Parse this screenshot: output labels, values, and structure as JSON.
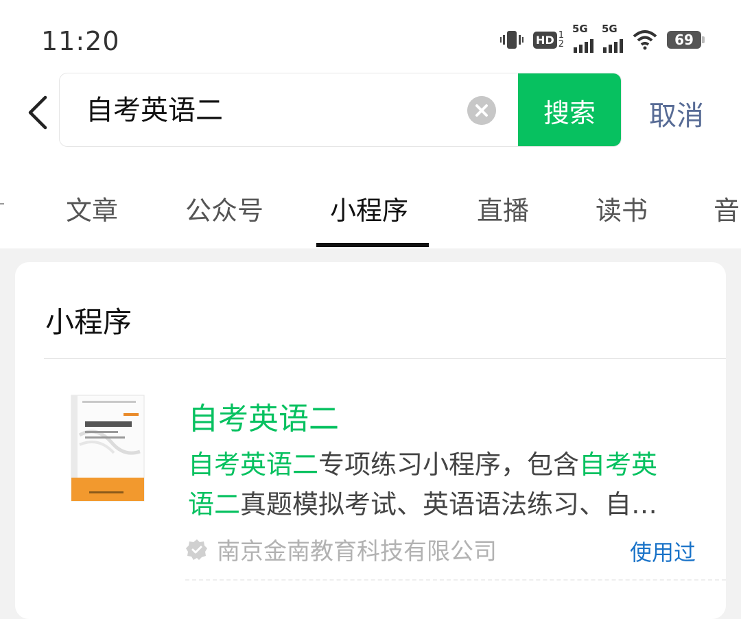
{
  "status_bar": {
    "time": "11:20",
    "battery": "69",
    "network_1": "5G",
    "network_2": "5G",
    "hd_label": "HD",
    "hd_sub_top": "1",
    "hd_sub_bottom": "2"
  },
  "search": {
    "value": "自考英语二",
    "button_label": "搜索",
    "cancel_label": "取消"
  },
  "tabs": [
    {
      "label": "文章"
    },
    {
      "label": "公众号"
    },
    {
      "label": "小程序",
      "active": true
    },
    {
      "label": "直播"
    },
    {
      "label": "读书"
    },
    {
      "label": "音"
    }
  ],
  "section": {
    "title": "小程序"
  },
  "result": {
    "title": "自考英语二",
    "desc_hl_1": "自考英语二",
    "desc_text_1": "专项练习小程序，包含",
    "desc_hl_2a": "自考英",
    "desc_hl_2b": "语二",
    "desc_text_2": "真题模拟考试、英语语法练习、自…",
    "company": "南京金南教育科技有限公司",
    "used_label": "使用过",
    "thumb_icon": "book-cover-icon"
  },
  "colors": {
    "accent": "#07c160",
    "link": "#576b95",
    "used": "#1a73c8"
  }
}
